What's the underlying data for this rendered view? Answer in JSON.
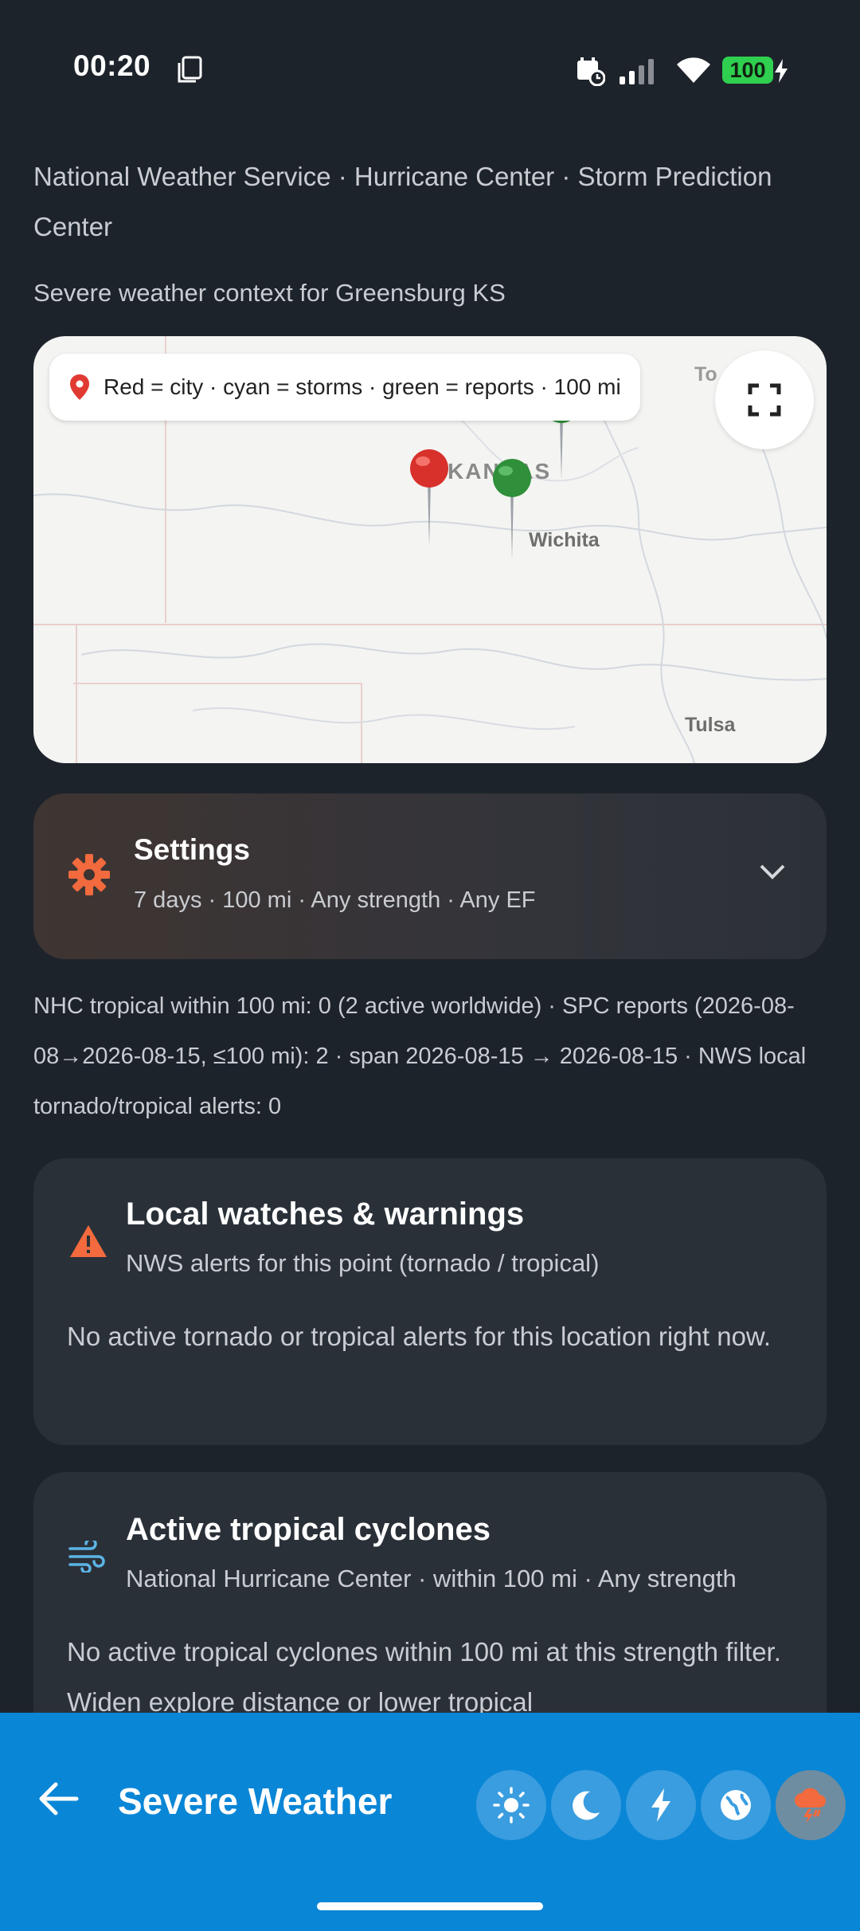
{
  "status_bar": {
    "time": "00:20",
    "battery": "100"
  },
  "header": {
    "sources": "National Weather Service · Hurricane Center · Storm Prediction Center",
    "context": "Severe weather context for Greensburg KS"
  },
  "map": {
    "legend": "Red = city · cyan = storms · green = reports · 100 mi",
    "labels": {
      "kansas": "KANSAS",
      "wichita": "Wichita",
      "tulsa": "Tulsa",
      "topeka": "To"
    }
  },
  "settings": {
    "title": "Settings",
    "subtitle": "7 days · 100 mi · Any strength · Any EF"
  },
  "summary": "NHC tropical within 100 mi: 0 (2 active worldwide) · SPC reports (2026-08-08→2026-08-15, ≤100 mi): 2 · span 2026-08-15 → 2026-08-15 · NWS local tornado/tropical alerts: 0",
  "alerts_card": {
    "title": "Local watches & warnings",
    "subtitle": "NWS alerts for this point (tornado / tropical)",
    "body": "No active tornado or tropical alerts for this location right now."
  },
  "cyclones_card": {
    "title": "Active tropical cyclones",
    "subtitle": "National Hurricane Center · within 100 mi · Any strength",
    "body": "No active tropical cyclones within 100 mi at this strength filter. Widen explore distance or lower tropical"
  },
  "bottom_bar": {
    "title": "Severe Weather",
    "modes": [
      "sun-icon",
      "moon-icon",
      "lightning-icon",
      "globe-icon",
      "storm-cloud-icon"
    ],
    "active_mode": "storm-cloud-icon"
  },
  "colors": {
    "background": "#1d232b",
    "accent_bar": "#0a86d6",
    "settings_gear": "#f26a3d",
    "warning": "#f26a3d",
    "wind": "#5bb4e6",
    "city_pin": "#d8312b",
    "report_pin": "#2f8f3a"
  }
}
